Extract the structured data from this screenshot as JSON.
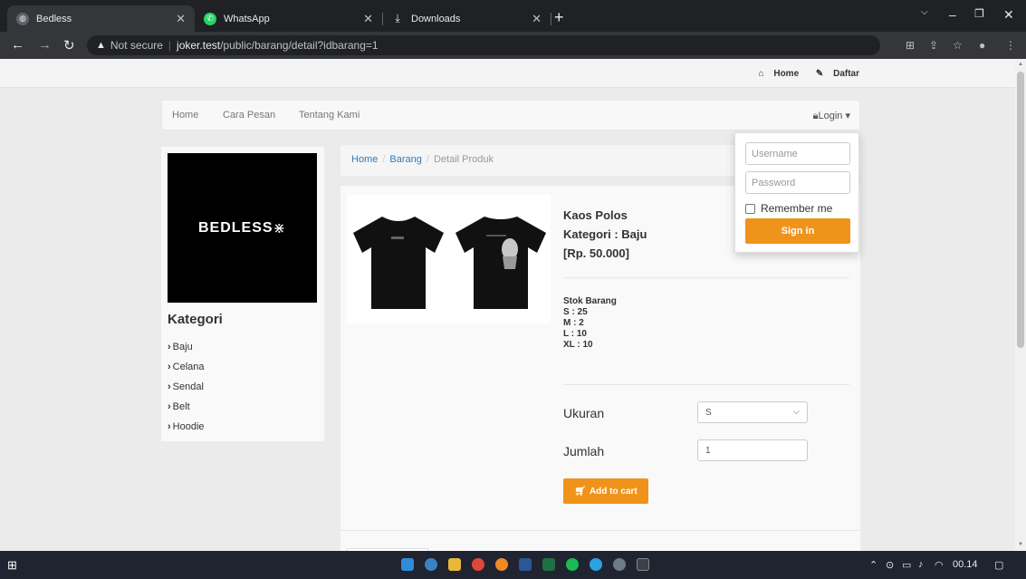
{
  "browser": {
    "tabs": [
      {
        "title": "Bedless",
        "icon": "globe-icon",
        "active": true
      },
      {
        "title": "WhatsApp",
        "icon": "whatsapp-icon",
        "active": false
      },
      {
        "title": "Downloads",
        "icon": "download-icon",
        "active": false
      }
    ],
    "address": {
      "security_label": "Not secure",
      "host": "joker.test",
      "path": "/public/barang/detail?idbarang=1"
    }
  },
  "site": {
    "top_links": {
      "home": "Home",
      "daftar": "Daftar"
    },
    "nav": {
      "items": [
        "Home",
        "Cara Pesan",
        "Tentang Kami"
      ],
      "login": "Login"
    },
    "brand": "BEDLESS",
    "sidebar": {
      "title": "Kategori",
      "categories": [
        "Baju",
        "Celana",
        "Sendal",
        "Belt",
        "Hoodie"
      ]
    },
    "breadcrumb": [
      "Home",
      "Barang",
      "Detail Produk"
    ],
    "product": {
      "name": "Kaos Polos",
      "category_line": "Kategori : Baju",
      "price": "[Rp. 50.000]",
      "stock_title": "Stok Barang",
      "stock": [
        "S : 25",
        "M : 2",
        "L : 10",
        "XL : 10"
      ],
      "size_label": "Ukuran",
      "size_value": "S",
      "qty_label": "Jumlah",
      "qty_value": "1",
      "add_to_cart": "Add to cart"
    },
    "login_dropdown": {
      "username_placeholder": "Username",
      "password_placeholder": "Password",
      "remember_label": "Remember me",
      "signin_label": "Sign in"
    },
    "accent_color": "#f0931a"
  },
  "taskbar": {
    "clock": "00.14"
  }
}
